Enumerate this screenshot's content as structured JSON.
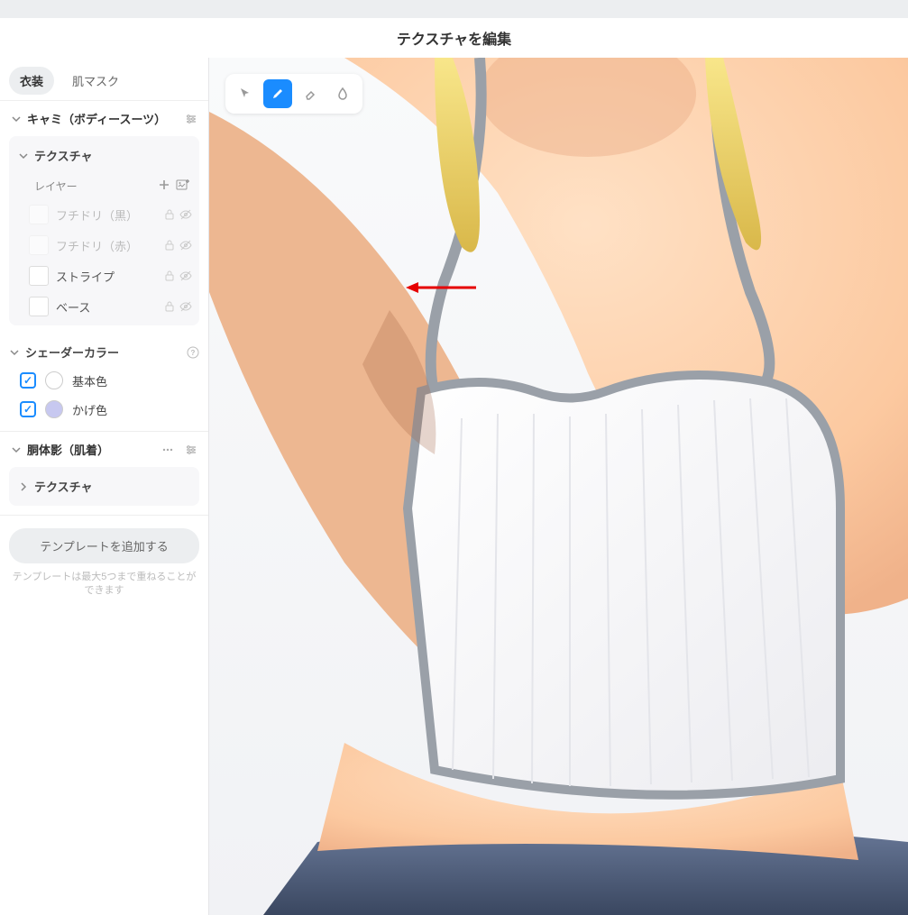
{
  "header": {
    "title": "テクスチャを編集"
  },
  "tabs": {
    "costume": "衣装",
    "skinmask": "肌マスク"
  },
  "category1": {
    "title": "キャミ（ボディースーツ）"
  },
  "texture_section": {
    "title": "テクスチャ",
    "layers_label": "レイヤー"
  },
  "layers": [
    {
      "label": "フチドリ（黒）"
    },
    {
      "label": "フチドリ（赤）"
    },
    {
      "label": "ストライプ"
    },
    {
      "label": "ベース"
    }
  ],
  "shader": {
    "title": "シェーダーカラー",
    "base": {
      "label": "基本色",
      "color": "#ffffff"
    },
    "shade": {
      "label": "かげ色",
      "color": "#c7c8f0"
    }
  },
  "category2": {
    "title": "胴体影（肌着）",
    "texture": "テクスチャ"
  },
  "template": {
    "button": "テンプレートを追加する",
    "help": "テンプレートは最大5つまで重ねることができます"
  },
  "tools": [
    "pointer",
    "pencil",
    "eraser",
    "drop"
  ]
}
